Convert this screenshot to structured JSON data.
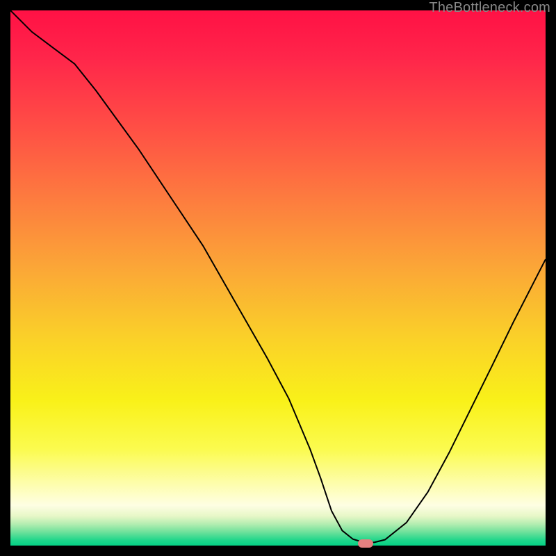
{
  "watermark": "TheBottleneck.com",
  "colors": {
    "markerFill": "#e48080",
    "curveStroke": "#000000"
  },
  "chart_data": {
    "type": "line",
    "title": "",
    "xlabel": "",
    "ylabel": "",
    "xlim": [
      0,
      100
    ],
    "ylim": [
      0,
      100
    ],
    "grid": false,
    "legend": false,
    "gradient_stops": [
      {
        "offset": 0,
        "color": "#ff1145"
      },
      {
        "offset": 0.09,
        "color": "#ff264a"
      },
      {
        "offset": 0.22,
        "color": "#ff4f45"
      },
      {
        "offset": 0.35,
        "color": "#fd7b3f"
      },
      {
        "offset": 0.48,
        "color": "#fba637"
      },
      {
        "offset": 0.61,
        "color": "#fad029"
      },
      {
        "offset": 0.73,
        "color": "#f9f119"
      },
      {
        "offset": 0.82,
        "color": "#fbfb4f"
      },
      {
        "offset": 0.88,
        "color": "#fdfda6"
      },
      {
        "offset": 0.925,
        "color": "#fefee3"
      },
      {
        "offset": 0.945,
        "color": "#e7f7c7"
      },
      {
        "offset": 0.96,
        "color": "#b3edb0"
      },
      {
        "offset": 0.975,
        "color": "#6de19b"
      },
      {
        "offset": 0.99,
        "color": "#1fd68b"
      },
      {
        "offset": 1.0,
        "color": "#04d185"
      }
    ],
    "curve": {
      "x": [
        0,
        4,
        8,
        12,
        16,
        20,
        24,
        28,
        32,
        36,
        40,
        44,
        48,
        52,
        56,
        58,
        60,
        62,
        64,
        66,
        68,
        70,
        74,
        78,
        82,
        86,
        90,
        94,
        98,
        100
      ],
      "y": [
        100,
        96,
        93,
        90,
        85,
        79.5,
        74,
        68,
        62,
        56,
        49,
        42,
        35,
        27.5,
        18,
        12.5,
        6.5,
        2.8,
        1.2,
        0.6,
        0.6,
        1.1,
        4.3,
        10,
        17.4,
        25.5,
        33.6,
        41.8,
        49.6,
        53.5
      ]
    },
    "marker": {
      "x": 66.3,
      "y": 0.4
    }
  }
}
